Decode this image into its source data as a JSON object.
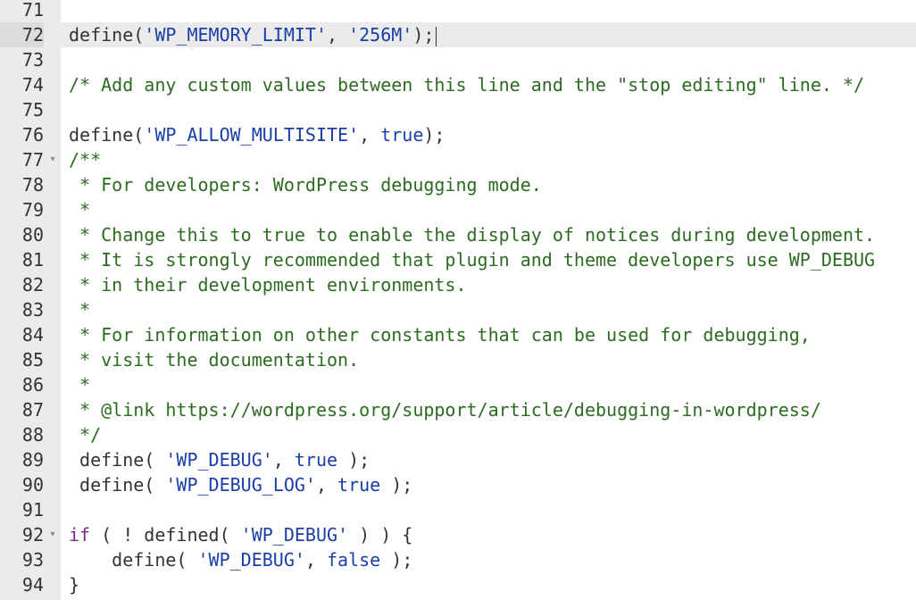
{
  "editor": {
    "language": "php",
    "active_line": 72,
    "colors": {
      "gutter_bg": "#ebebeb",
      "active_line_bg": "#ebebeb",
      "string": "#1a3ea8",
      "keyword": "#1a3ea8",
      "control": "#7a2a83",
      "comment": "#2d6a22",
      "default": "#333333"
    },
    "lines": [
      {
        "number": "71",
        "fold": "",
        "tokens": []
      },
      {
        "number": "72",
        "fold": "",
        "tokens": [
          {
            "t": "fn",
            "v": "define("
          },
          {
            "t": "str",
            "v": "'WP_MEMORY_LIMIT'"
          },
          {
            "t": "p",
            "v": ", "
          },
          {
            "t": "str",
            "v": "'256M'"
          },
          {
            "t": "p",
            "v": ");"
          }
        ]
      },
      {
        "number": "73",
        "fold": "",
        "tokens": []
      },
      {
        "number": "74",
        "fold": "",
        "tokens": [
          {
            "t": "cm",
            "v": "/* Add any custom values between this line and the \"stop editing\" line. */"
          }
        ]
      },
      {
        "number": "75",
        "fold": "",
        "tokens": []
      },
      {
        "number": "76",
        "fold": "",
        "tokens": [
          {
            "t": "fn",
            "v": "define("
          },
          {
            "t": "str",
            "v": "'WP_ALLOW_MULTISITE'"
          },
          {
            "t": "p",
            "v": ", "
          },
          {
            "t": "kw",
            "v": "true"
          },
          {
            "t": "p",
            "v": ");"
          }
        ]
      },
      {
        "number": "77",
        "fold": "▾",
        "tokens": [
          {
            "t": "cm",
            "v": "/**"
          }
        ]
      },
      {
        "number": "78",
        "fold": "",
        "tokens": [
          {
            "t": "cm",
            "v": " * For developers: WordPress debugging mode."
          }
        ]
      },
      {
        "number": "79",
        "fold": "",
        "tokens": [
          {
            "t": "cm",
            "v": " *"
          }
        ]
      },
      {
        "number": "80",
        "fold": "",
        "tokens": [
          {
            "t": "cm",
            "v": " * Change this to true to enable the display of notices during development."
          }
        ]
      },
      {
        "number": "81",
        "fold": "",
        "tokens": [
          {
            "t": "cm",
            "v": " * It is strongly recommended that plugin and theme developers use WP_DEBUG"
          }
        ]
      },
      {
        "number": "82",
        "fold": "",
        "tokens": [
          {
            "t": "cm",
            "v": " * in their development environments."
          }
        ]
      },
      {
        "number": "83",
        "fold": "",
        "tokens": [
          {
            "t": "cm",
            "v": " *"
          }
        ]
      },
      {
        "number": "84",
        "fold": "",
        "tokens": [
          {
            "t": "cm",
            "v": " * For information on other constants that can be used for debugging,"
          }
        ]
      },
      {
        "number": "85",
        "fold": "",
        "tokens": [
          {
            "t": "cm",
            "v": " * visit the documentation."
          }
        ]
      },
      {
        "number": "86",
        "fold": "",
        "tokens": [
          {
            "t": "cm",
            "v": " *"
          }
        ]
      },
      {
        "number": "87",
        "fold": "",
        "tokens": [
          {
            "t": "cm",
            "v": " * @link https://wordpress.org/support/article/debugging-in-wordpress/"
          }
        ]
      },
      {
        "number": "88",
        "fold": "",
        "tokens": [
          {
            "t": "cm",
            "v": " */"
          }
        ]
      },
      {
        "number": "89",
        "fold": "",
        "tokens": [
          {
            "t": "fn",
            "v": " define( "
          },
          {
            "t": "str",
            "v": "'WP_DEBUG'"
          },
          {
            "t": "p",
            "v": ", "
          },
          {
            "t": "kw",
            "v": "true"
          },
          {
            "t": "p",
            "v": " );"
          }
        ]
      },
      {
        "number": "90",
        "fold": "",
        "tokens": [
          {
            "t": "fn",
            "v": " define( "
          },
          {
            "t": "str",
            "v": "'WP_DEBUG_LOG'"
          },
          {
            "t": "p",
            "v": ", "
          },
          {
            "t": "kw",
            "v": "true"
          },
          {
            "t": "p",
            "v": " );"
          }
        ]
      },
      {
        "number": "91",
        "fold": "",
        "tokens": []
      },
      {
        "number": "92",
        "fold": "▾",
        "tokens": [
          {
            "t": "ctl",
            "v": "if"
          },
          {
            "t": "p",
            "v": " ( ! defined( "
          },
          {
            "t": "str",
            "v": "'WP_DEBUG'"
          },
          {
            "t": "p",
            "v": " ) ) {"
          }
        ]
      },
      {
        "number": "93",
        "fold": "",
        "tokens": [
          {
            "t": "fn",
            "v": "    define( "
          },
          {
            "t": "str",
            "v": "'WP_DEBUG'"
          },
          {
            "t": "p",
            "v": ", "
          },
          {
            "t": "kw",
            "v": "false"
          },
          {
            "t": "p",
            "v": " );"
          }
        ]
      },
      {
        "number": "94",
        "fold": "",
        "tokens": [
          {
            "t": "p",
            "v": "}"
          }
        ]
      }
    ]
  }
}
